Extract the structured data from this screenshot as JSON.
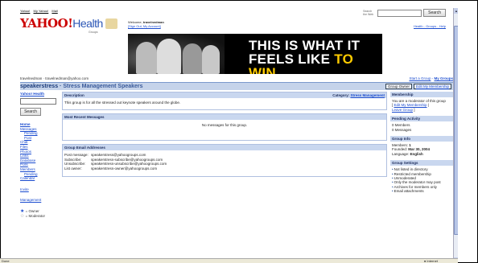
{
  "top_nav": {
    "links": [
      "Yahoo!",
      "My Yahoo!",
      "Mail"
    ]
  },
  "search_top": {
    "label": "Search the Web",
    "button": "Search"
  },
  "logo": {
    "yahoo": "YAHOO!",
    "health": "Health",
    "groups": "Groups"
  },
  "welcome": {
    "prefix": "Welcome,",
    "user": "travelnedman",
    "links": "[Sign Out, My Account]"
  },
  "top_right_links": "Health - Groups - Help",
  "banner": {
    "line1": "THIS IS WHAT IT",
    "line2_prefix": "FEELS LIKE",
    "line2_accent": "TO WIN."
  },
  "user_line": "travelnedman · travelnedman@yahoo.com",
  "start_group": {
    "start": "Start a Group",
    "sep": " - ",
    "my": "My Groups"
  },
  "title_bar": {
    "group_name": "speakerstress",
    "separator": " · ",
    "group_desc": "Stress Management Speakers",
    "owner_badge": "Group Owner",
    "edit_link": "Edit My Membership"
  },
  "sidebar": {
    "yahoo_health": "Yahoo! Health",
    "search_button": "Search",
    "nav": [
      {
        "label": "Home",
        "cls": "home"
      },
      {
        "label": "Messages",
        "cls": ""
      },
      {
        "label": "Pending",
        "cls": "sub"
      },
      {
        "label": "Post",
        "cls": "sub"
      },
      {
        "label": "Chat",
        "cls": ""
      },
      {
        "label": "Files",
        "cls": ""
      },
      {
        "label": "Photos",
        "cls": ""
      },
      {
        "label": "Links",
        "cls": ""
      },
      {
        "label": "Database",
        "cls": ""
      },
      {
        "label": "Polls",
        "cls": ""
      },
      {
        "label": "Members",
        "cls": ""
      },
      {
        "label": "Pending",
        "cls": "sub"
      },
      {
        "label": "Calendar",
        "cls": ""
      }
    ],
    "invite": "Invite",
    "management": "Management",
    "legend_owner": "= Owner",
    "legend_moderator": "= Moderator"
  },
  "main": {
    "description": {
      "header": "Description",
      "category_label": "Category:",
      "category_value": "Stress Management",
      "text": "This group is for all the stressed out keynote speakers around the globe."
    },
    "recent": {
      "header": "Most Recent Messages",
      "text": "No messages for this group."
    },
    "email": {
      "header": "Group Email Addresses",
      "rows": [
        {
          "k": "Post message:",
          "v": "speakerstress@yahoogroups.com"
        },
        {
          "k": "Subscribe:",
          "v": "speakerstress-subscribe@yahoogroups.com"
        },
        {
          "k": "Unsubscribe:",
          "v": "speakerstress-unsubscribe@yahoogroups.com"
        },
        {
          "k": "List owner:",
          "v": "speakerstress-owner@yahoogroups.com"
        }
      ]
    }
  },
  "right": {
    "membership": {
      "header": "Membership",
      "text": "You are a moderator of this group",
      "edit": "Edit My Membership",
      "leave": "Leave Group"
    },
    "pending": {
      "header": "Pending Activity",
      "members": "0 Members",
      "messages": "0 Messages"
    },
    "info": {
      "header": "Group Info",
      "members_label": "Members:",
      "members_value": "1",
      "founded_label": "Founded:",
      "founded_value": "Mar 30, 2004",
      "language_label": "Language:",
      "language_value": "English"
    },
    "settings": {
      "header": "Group Settings",
      "items": [
        "Not listed in directory",
        "Restricted membership",
        "Unmoderated",
        "Only the moderator may post",
        "Archives for members only",
        "Email attachments"
      ]
    }
  },
  "status_bar": {
    "left": "Done",
    "zone": "Internet"
  }
}
